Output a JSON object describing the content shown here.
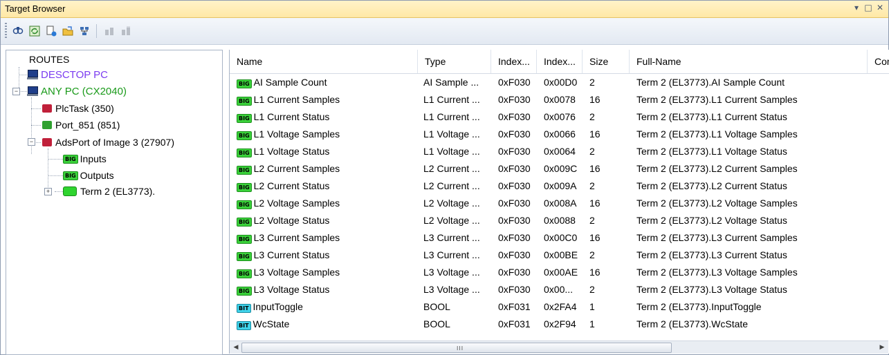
{
  "window": {
    "title": "Target Browser",
    "controls": [
      "▾",
      "□",
      "✕"
    ]
  },
  "toolbar": {
    "icons": [
      "find-icon",
      "refresh-icon",
      "add-route-icon",
      "open-folder-icon",
      "network-scan-icon",
      "disabled-tool-icon-1",
      "disabled-tool-icon-2"
    ]
  },
  "tree": {
    "root": "ROUTES",
    "nodes": [
      {
        "label": "DESCTOP PC",
        "color": "#7b3cf0",
        "icon": "pc-icon"
      },
      {
        "label": "ANY PC (CX2040)",
        "color": "#1a9a1a",
        "icon": "pc-icon"
      },
      {
        "label": "PlcTask (350)",
        "icon": "task-icon-red"
      },
      {
        "label": "Port_851 (851)",
        "icon": "task-icon-green"
      },
      {
        "label": "AdsPort of Image 3 (27907)",
        "icon": "task-icon-red"
      },
      {
        "label": "Inputs",
        "icon": "big-badge"
      },
      {
        "label": "Outputs",
        "icon": "big-badge"
      },
      {
        "label": "Term 2 (EL3773).",
        "icon": "term-icon"
      }
    ]
  },
  "list": {
    "columns": [
      "Name",
      "Type",
      "Index...",
      "Index...",
      "Size",
      "Full-Name",
      "Cor"
    ],
    "rows": [
      {
        "badge": "BIG",
        "name": "AI Sample Count",
        "type": "AI Sample ...",
        "idx1": "0xF030",
        "idx2": "0x00D0",
        "size": "2",
        "full": "Term 2 (EL3773).AI Sample Count"
      },
      {
        "badge": "BIG",
        "name": "L1 Current Samples",
        "type": "L1 Current ...",
        "idx1": "0xF030",
        "idx2": "0x0078",
        "size": "16",
        "full": "Term 2 (EL3773).L1 Current Samples"
      },
      {
        "badge": "BIG",
        "name": "L1 Current Status",
        "type": "L1 Current ...",
        "idx1": "0xF030",
        "idx2": "0x0076",
        "size": "2",
        "full": "Term 2 (EL3773).L1 Current Status"
      },
      {
        "badge": "BIG",
        "name": "L1 Voltage Samples",
        "type": "L1 Voltage ...",
        "idx1": "0xF030",
        "idx2": "0x0066",
        "size": "16",
        "full": "Term 2 (EL3773).L1 Voltage Samples"
      },
      {
        "badge": "BIG",
        "name": "L1 Voltage Status",
        "type": "L1 Voltage ...",
        "idx1": "0xF030",
        "idx2": "0x0064",
        "size": "2",
        "full": "Term 2 (EL3773).L1 Voltage Status"
      },
      {
        "badge": "BIG",
        "name": "L2 Current Samples",
        "type": "L2 Current ...",
        "idx1": "0xF030",
        "idx2": "0x009C",
        "size": "16",
        "full": "Term 2 (EL3773).L2 Current Samples"
      },
      {
        "badge": "BIG",
        "name": "L2 Current Status",
        "type": "L2 Current ...",
        "idx1": "0xF030",
        "idx2": "0x009A",
        "size": "2",
        "full": "Term 2 (EL3773).L2 Current Status"
      },
      {
        "badge": "BIG",
        "name": "L2 Voltage Samples",
        "type": "L2 Voltage ...",
        "idx1": "0xF030",
        "idx2": "0x008A",
        "size": "16",
        "full": "Term 2 (EL3773).L2 Voltage Samples"
      },
      {
        "badge": "BIG",
        "name": "L2 Voltage Status",
        "type": "L2 Voltage ...",
        "idx1": "0xF030",
        "idx2": "0x0088",
        "size": "2",
        "full": "Term 2 (EL3773).L2 Voltage Status"
      },
      {
        "badge": "BIG",
        "name": "L3 Current Samples",
        "type": "L3 Current ...",
        "idx1": "0xF030",
        "idx2": "0x00C0",
        "size": "16",
        "full": "Term 2 (EL3773).L3 Current Samples"
      },
      {
        "badge": "BIG",
        "name": "L3 Current Status",
        "type": "L3 Current ...",
        "idx1": "0xF030",
        "idx2": "0x00BE",
        "size": "2",
        "full": "Term 2 (EL3773).L3 Current Status"
      },
      {
        "badge": "BIG",
        "name": "L3 Voltage Samples",
        "type": "L3 Voltage ...",
        "idx1": "0xF030",
        "idx2": "0x00AE",
        "size": "16",
        "full": "Term 2 (EL3773).L3 Voltage Samples"
      },
      {
        "badge": "BIG",
        "name": "L3 Voltage Status",
        "type": "L3 Voltage ...",
        "idx1": "0xF030",
        "idx2": "0x00...",
        "size": "2",
        "full": "Term 2 (EL3773).L3 Voltage Status"
      },
      {
        "badge": "BIT",
        "name": "InputToggle",
        "type": "BOOL",
        "idx1": "0xF031",
        "idx2": "0x2FA4",
        "size": "1",
        "full": "Term 2 (EL3773).InputToggle"
      },
      {
        "badge": "BIT",
        "name": "WcState",
        "type": "BOOL",
        "idx1": "0xF031",
        "idx2": "0x2F94",
        "size": "1",
        "full": "Term 2 (EL3773).WcState"
      }
    ]
  },
  "scrollbar": {
    "left_arrow": "◀",
    "right_arrow": "▶",
    "grip": "III"
  },
  "colors": {
    "titlebar": "#ffe8a6",
    "big_badge": "#3ad13a",
    "bit_badge": "#3fd3ea",
    "descto_pc": "#7b3cf0",
    "any_pc": "#1a9a1a"
  }
}
